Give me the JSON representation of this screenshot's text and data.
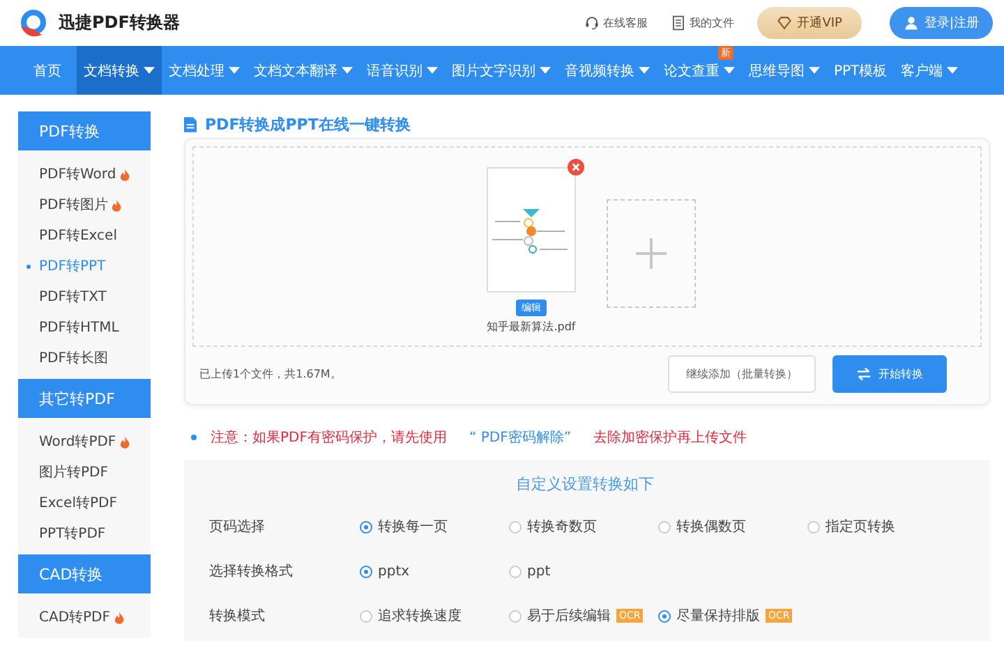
{
  "header": {
    "logo_text": "迅捷PDF转换器",
    "links": [
      {
        "kind": "headset",
        "label": "在线客服"
      },
      {
        "kind": "file",
        "label": "我的文件"
      }
    ],
    "vip_button": "开通VIP",
    "login_button": "登录|注册"
  },
  "nav": {
    "items": [
      {
        "label": "首页",
        "selected": false,
        "dropdown": false
      },
      {
        "label": "文档转换",
        "selected": true,
        "dropdown": true
      },
      {
        "label": "文档处理",
        "selected": false,
        "dropdown": true
      },
      {
        "label": "文档文本翻译",
        "selected": false,
        "dropdown": true
      },
      {
        "label": "语音识别",
        "selected": false,
        "dropdown": true
      },
      {
        "label": "图片文字识别",
        "selected": false,
        "dropdown": true
      },
      {
        "label": "音视频转换",
        "selected": false,
        "dropdown": true
      },
      {
        "label": "论文查重",
        "selected": false,
        "dropdown": true,
        "badge": "新"
      },
      {
        "label": "思维导图",
        "selected": false,
        "dropdown": true
      },
      {
        "label": "PPT模板",
        "selected": false,
        "dropdown": false
      },
      {
        "label": "客户端",
        "selected": false,
        "dropdown": true
      }
    ]
  },
  "sidebar": {
    "groups": [
      {
        "title": "PDF转换",
        "items": [
          {
            "label": "PDF转Word",
            "hot": true,
            "selected": false
          },
          {
            "label": "PDF转图片",
            "hot": true,
            "selected": false
          },
          {
            "label": "PDF转Excel",
            "hot": false,
            "selected": false
          },
          {
            "label": "PDF转PPT",
            "hot": false,
            "selected": true
          },
          {
            "label": "PDF转TXT",
            "hot": false,
            "selected": false
          },
          {
            "label": "PDF转HTML",
            "hot": false,
            "selected": false
          },
          {
            "label": "PDF转长图",
            "hot": false,
            "selected": false
          }
        ]
      },
      {
        "title": "其它转PDF",
        "items": [
          {
            "label": "Word转PDF",
            "hot": true,
            "selected": false
          },
          {
            "label": "图片转PDF",
            "hot": false,
            "selected": false
          },
          {
            "label": "Excel转PDF",
            "hot": false,
            "selected": false
          },
          {
            "label": "PPT转PDF",
            "hot": false,
            "selected": false
          }
        ]
      },
      {
        "title": "CAD转换",
        "items": [
          {
            "label": "CAD转PDF",
            "hot": true,
            "selected": false
          }
        ]
      }
    ]
  },
  "main": {
    "title": "PDF转换成PPT在线一键转换",
    "upload": {
      "files": [
        {
          "name": "知乎最新算法.pdf",
          "edit_label": "编辑"
        }
      ],
      "summary": "已上传1个文件，共1.67M。",
      "add_more_button": "继续添加（批量转换）",
      "start_button": "开始转换"
    },
    "notice": {
      "before": "注意：如果PDF有密码保护，请先使用",
      "link": "“ PDF密码解除”",
      "after": "去除加密保护再上传文件"
    },
    "settings": {
      "title": "自定义设置转换如下",
      "rows": [
        {
          "label": "页码选择",
          "options": [
            {
              "label": "转换每一页",
              "selected": true
            },
            {
              "label": "转换奇数页",
              "selected": false
            },
            {
              "label": "转换偶数页",
              "selected": false
            },
            {
              "label": "指定页转换",
              "selected": false
            }
          ]
        },
        {
          "label": "选择转换格式",
          "options": [
            {
              "label": "pptx",
              "selected": true
            },
            {
              "label": "ppt",
              "selected": false
            }
          ]
        },
        {
          "label": "转换模式",
          "options": [
            {
              "label": "追求转换速度",
              "selected": false
            },
            {
              "label": "易于后续编辑",
              "selected": false,
              "badge": "OCR"
            },
            {
              "label": "尽量保持排版",
              "selected": true,
              "badge": "OCR"
            }
          ]
        }
      ]
    }
  }
}
